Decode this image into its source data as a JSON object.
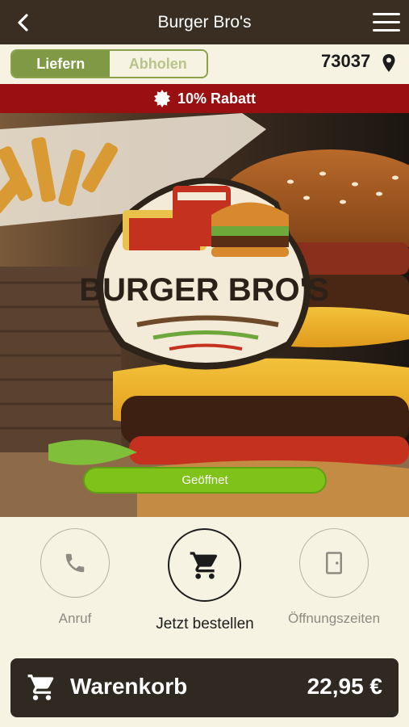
{
  "header": {
    "title": "Burger Bro's"
  },
  "delivery_toggle": {
    "options": [
      {
        "label": "Liefern",
        "active": true
      },
      {
        "label": "Abholen",
        "active": false
      }
    ]
  },
  "location": {
    "zip": "73037"
  },
  "promo": {
    "text": "10% Rabatt"
  },
  "logo": {
    "text": "BURGER BRO'S"
  },
  "status": {
    "label": "Geöffnet"
  },
  "actions": [
    {
      "label": "Anruf",
      "icon": "phone-icon"
    },
    {
      "label": "Jetzt bestellen",
      "icon": "cart-icon"
    },
    {
      "label": "Öffnungszeiten",
      "icon": "door-icon"
    }
  ],
  "cart": {
    "label": "Warenkorb",
    "total": "22,95 €"
  },
  "colors": {
    "topbar": "#3a2e22",
    "accent_green": "#7f9944",
    "promo_red": "#9a0f10",
    "status_green": "#7ec21a",
    "cart_bar": "#2f2921",
    "background": "#f6f3e2"
  }
}
